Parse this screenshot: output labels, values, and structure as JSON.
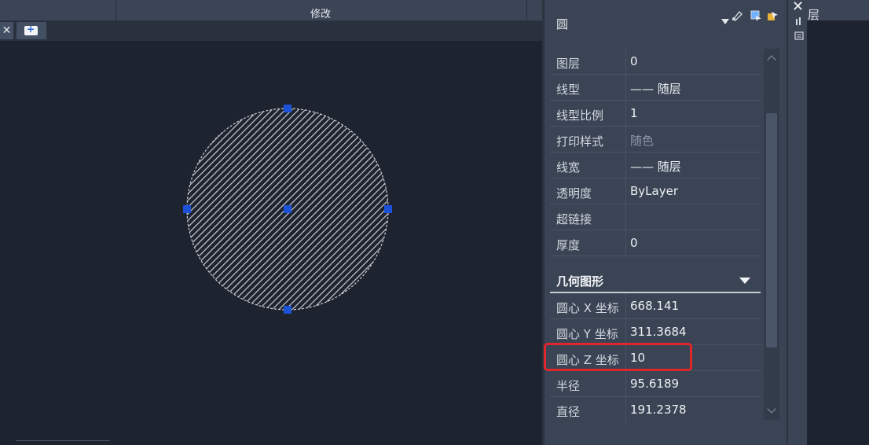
{
  "ribbon": {
    "panel_label": "修改",
    "layer_label": "层"
  },
  "toolbar": {
    "close_glyph": "✕"
  },
  "canvas": {
    "object": "circle",
    "hatch_color": "#c9ccd2",
    "grip_color": "#1c52d8"
  },
  "properties": {
    "object_type": "圆",
    "general": [
      {
        "label": "图层",
        "value": "0"
      },
      {
        "label": "线型",
        "value": "—— 随层"
      },
      {
        "label": "线型比例",
        "value": "1"
      },
      {
        "label": "打印样式",
        "value": "随色"
      },
      {
        "label": "线宽",
        "value": "—— 随层"
      },
      {
        "label": "透明度",
        "value": "ByLayer"
      },
      {
        "label": "超链接",
        "value": ""
      },
      {
        "label": "厚度",
        "value": "0"
      }
    ],
    "geometry_title": "几何图形",
    "geometry": [
      {
        "label": "圆心 X 坐标",
        "value": "668.141"
      },
      {
        "label": "圆心 Y 坐标",
        "value": "311.3684"
      },
      {
        "label": "圆心 Z 坐标",
        "value": "10"
      },
      {
        "label": "半径",
        "value": "95.6189"
      },
      {
        "label": "直径",
        "value": "191.2378"
      }
    ],
    "highlight_color": "#e0262a"
  },
  "icons": [
    "dropdown-arrow-icon",
    "quick-select-icon",
    "select-objects-icon",
    "toggle-pickadd-icon",
    "close-icon"
  ]
}
